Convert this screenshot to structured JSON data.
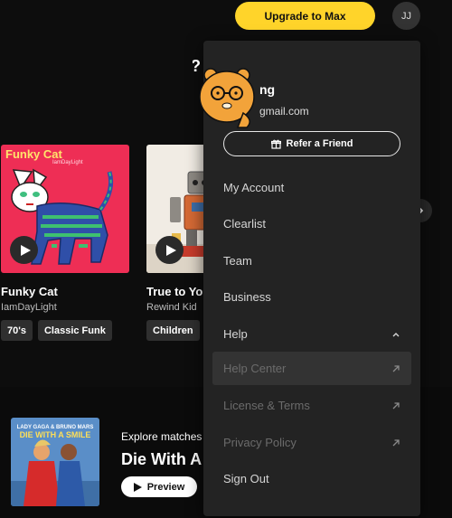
{
  "header": {
    "upgrade_label": "Upgrade to Max",
    "avatar_initials": "JJ"
  },
  "cards": [
    {
      "art_title": "Funky Cat",
      "art_artist": "IamDayLight",
      "title": "Funky Cat",
      "subtitle": "IamDayLight",
      "tags": [
        "70's",
        "Classic Funk"
      ]
    },
    {
      "title": "True to You",
      "subtitle": "Rewind Kid",
      "tags": [
        "Children"
      ]
    }
  ],
  "feature": {
    "cover_artist": "LADY GAGA & BRUNO MARS",
    "cover_title": "DIE WITH A SMILE",
    "kicker": "Explore matches",
    "title": "Die With A",
    "preview_label": "Preview"
  },
  "menu": {
    "name": "ng",
    "email": "gmail.com",
    "refer_label": "Refer a Friend",
    "items": [
      {
        "label": "My Account"
      },
      {
        "label": "Clearlist"
      },
      {
        "label": "Team"
      },
      {
        "label": "Business"
      },
      {
        "label": "Help"
      },
      {
        "label": "Help Center"
      },
      {
        "label": "License & Terms"
      },
      {
        "label": "Privacy Policy"
      },
      {
        "label": "Sign Out"
      }
    ]
  },
  "icons": {
    "chevron_up": "chevron-up-icon",
    "external_link": "external-link-icon",
    "gift": "gift-icon",
    "play": "play-icon"
  },
  "colors": {
    "accent": "#ffd42a",
    "menu_bg": "#232323",
    "page_bg": "#0d0d0d"
  }
}
